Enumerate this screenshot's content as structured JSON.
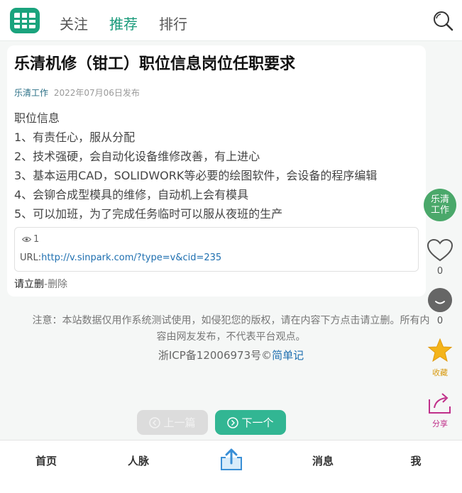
{
  "header": {
    "tabs": [
      {
        "label": "关注"
      },
      {
        "label": "推荐"
      },
      {
        "label": "排行"
      }
    ],
    "active_tab": "推荐",
    "accent_color": "#199a7a"
  },
  "article": {
    "title": "乐清机修（钳工）职位信息岗位任职要求",
    "author": "乐清工作",
    "date": "2022年07月06日发布",
    "lines": [
      "职位信息",
      "1、有责任心，服从分配",
      "2、技术强硬，会自动化设备维修改善，有上进心",
      "3、基本运用CAD，SOLIDWORK等必要的绘图软件，会设备的程序编辑",
      "4、会铆合成型模具的维修，自动机上会有模具",
      "5、可以加班，为了完成任务临时可以服从夜班的生产"
    ],
    "views": "1",
    "url_label": "URL:",
    "url": "http://v.sinpark.com/?type=v&cid=235",
    "claim_label": "请立删",
    "separator": "-",
    "delete_label": "删除"
  },
  "notice": {
    "line1": "注意：本站数据仅用作系统测试使用，如侵犯您的版权，请在内容下方点击请立删。所有内",
    "line2": "容由网友发布，不代表平台观点。",
    "icp_prefix": "浙ICP备12006973号©",
    "icp_link": "简单记"
  },
  "side": {
    "avatar_text": "乐清工作",
    "like_count": "0",
    "comment_count": "0",
    "fav_label": "收藏",
    "share_label": "分享"
  },
  "pager": {
    "prev_label": "上一篇",
    "next_label": "下一个"
  },
  "bottom_nav": {
    "items": [
      {
        "label": "首页"
      },
      {
        "label": "人脉"
      },
      {
        "label": "消息"
      },
      {
        "label": "我"
      }
    ]
  }
}
